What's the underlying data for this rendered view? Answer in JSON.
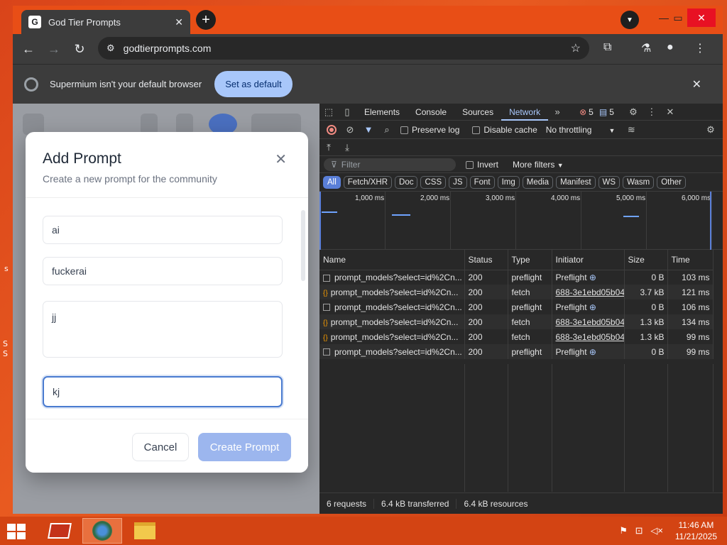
{
  "browser": {
    "tab_title": "God Tier Prompts",
    "tab_favicon": "G",
    "url": "godtierprompts.com"
  },
  "infobar": {
    "message": "Supermium isn't your default browser",
    "button": "Set as default"
  },
  "modal": {
    "title": "Add Prompt",
    "subtitle": "Create a new prompt for the community",
    "field1": "ai",
    "field2": "fuckerai",
    "field3": "jj",
    "field4": "kj",
    "cancel": "Cancel",
    "create": "Create Prompt"
  },
  "devtools": {
    "tabs": [
      "Elements",
      "Console",
      "Sources",
      "Network"
    ],
    "errors": "5",
    "messages": "5",
    "preserve_log": "Preserve log",
    "disable_cache": "Disable cache",
    "throttling": "No throttling",
    "filter_placeholder": "Filter",
    "invert": "Invert",
    "more_filters": "More filters",
    "chips": [
      "All",
      "Fetch/XHR",
      "Doc",
      "CSS",
      "JS",
      "Font",
      "Img",
      "Media",
      "Manifest",
      "WS",
      "Wasm",
      "Other"
    ],
    "timeline_labels": [
      "1,000 ms",
      "2,000 ms",
      "3,000 ms",
      "4,000 ms",
      "5,000 ms",
      "6,000 ms"
    ],
    "columns": [
      "Name",
      "Status",
      "Type",
      "Initiator",
      "Size",
      "Time"
    ],
    "rows": [
      {
        "name": "prompt_models?select=id%2Cn...",
        "status": "200",
        "type": "preflight",
        "initiator": "Preflight",
        "size": "0 B",
        "time": "103 ms",
        "kind": "preflight"
      },
      {
        "name": "prompt_models?select=id%2Cn...",
        "status": "200",
        "type": "fetch",
        "initiator": "688-3e1ebd05b04",
        "size": "3.7 kB",
        "time": "121 ms",
        "kind": "fetch"
      },
      {
        "name": "prompt_models?select=id%2Cn...",
        "status": "200",
        "type": "preflight",
        "initiator": "Preflight",
        "size": "0 B",
        "time": "106 ms",
        "kind": "preflight"
      },
      {
        "name": "prompt_models?select=id%2Cn...",
        "status": "200",
        "type": "fetch",
        "initiator": "688-3e1ebd05b04",
        "size": "1.3 kB",
        "time": "134 ms",
        "kind": "fetch"
      },
      {
        "name": "prompt_models?select=id%2Cn...",
        "status": "200",
        "type": "fetch",
        "initiator": "688-3e1ebd05b04",
        "size": "1.3 kB",
        "time": "99 ms",
        "kind": "fetch"
      },
      {
        "name": "prompt_models?select=id%2Cn...",
        "status": "200",
        "type": "preflight",
        "initiator": "Preflight",
        "size": "0 B",
        "time": "99 ms",
        "kind": "preflight"
      }
    ],
    "summary": {
      "requests": "6 requests",
      "transferred": "6.4 kB transferred",
      "resources": "6.4 kB resources"
    }
  },
  "taskbar": {
    "time": "11:46 AM",
    "date": "11/21/2025"
  }
}
